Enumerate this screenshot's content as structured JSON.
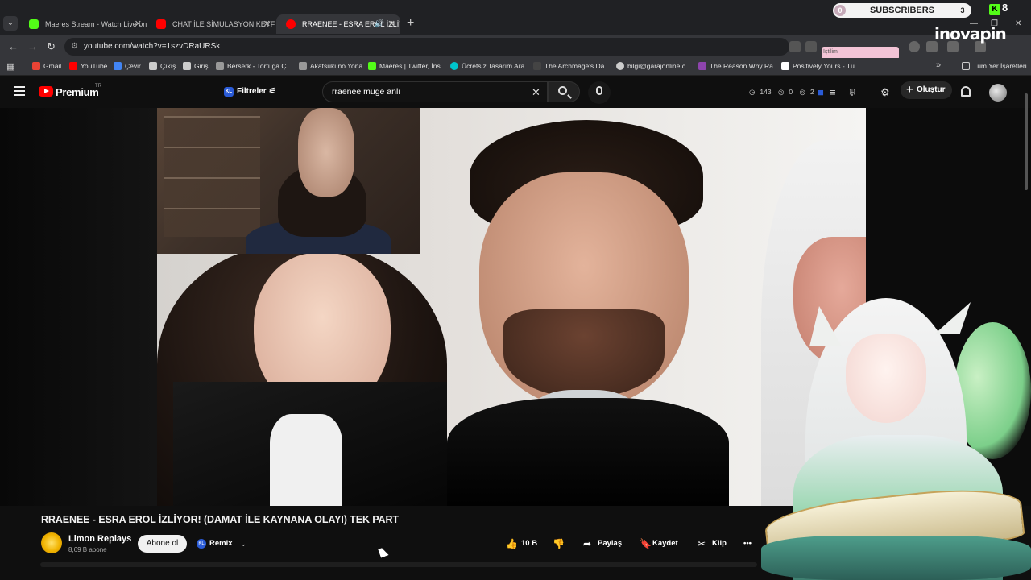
{
  "browser": {
    "tabs": [
      {
        "title": "Maeres Stream - Watch Live on",
        "favicon_color": "#53fc18"
      },
      {
        "title": "CHAT İLE SİMULASYON KEYFİ |",
        "favicon_color": "#ff0000"
      },
      {
        "title": "RRAENEE - ESRA EROL İZLİY",
        "favicon_color": "#ff0000",
        "active": true
      }
    ],
    "url": "youtube.com/watch?v=1szvDRaURSk",
    "bookmarks": [
      {
        "label": "Gmail",
        "color": "#ea4335"
      },
      {
        "label": "YouTube",
        "color": "#ff0000"
      },
      {
        "label": "Çevir",
        "color": "#4285f4"
      },
      {
        "label": "Çıkış",
        "color": "#cccccc"
      },
      {
        "label": "Giriş",
        "color": "#cccccc"
      },
      {
        "label": "Berserk - Tortuga Ç...",
        "color": "#999999"
      },
      {
        "label": "Akatsuki no Yona",
        "color": "#999999"
      },
      {
        "label": "Maeres | Twitter, İns...",
        "color": "#53fc18"
      },
      {
        "label": "Ücretsiz Tasarım Ara...",
        "color": "#00c4cc"
      },
      {
        "label": "The Archmage's Da...",
        "color": "#444444"
      },
      {
        "label": "bilgi@garajonline.c...",
        "color": "#cccccc"
      },
      {
        "label": "The Reason Why Ra...",
        "color": "#8e44ad"
      },
      {
        "label": "Positively Yours - Tü...",
        "color": "#ffffff"
      }
    ],
    "bookmarks_all": "Tüm Yer İşaretleri",
    "overlay_subscribers": {
      "label": "SUBSCRIBERS",
      "left": "0",
      "right": "3"
    },
    "overlay_kick": "8",
    "overlay_brand": "inovapin",
    "pink_tag": "İştilim"
  },
  "youtube": {
    "brand": "Premium",
    "region": "TR",
    "filters_label": "Filtreler",
    "search_query": "rraenee müge anlı",
    "counters": {
      "views": "143",
      "a": "0",
      "b": "2"
    },
    "create_label": "Oluştur",
    "video_title": "RRAENEE - ESRA EROL İZLİYOR! (DAMAT İLE KAYNANA OLAYI) TEK PART",
    "channel_name": "Limon Replays",
    "subscribers": "8,69 B abone",
    "subscribe_label": "Abone ol",
    "remix_label": "Remix",
    "like_count": "10 B",
    "share_label": "Paylaş",
    "save_label": "Kaydet",
    "clip_label": "Klip",
    "accent": "#ff0000"
  }
}
